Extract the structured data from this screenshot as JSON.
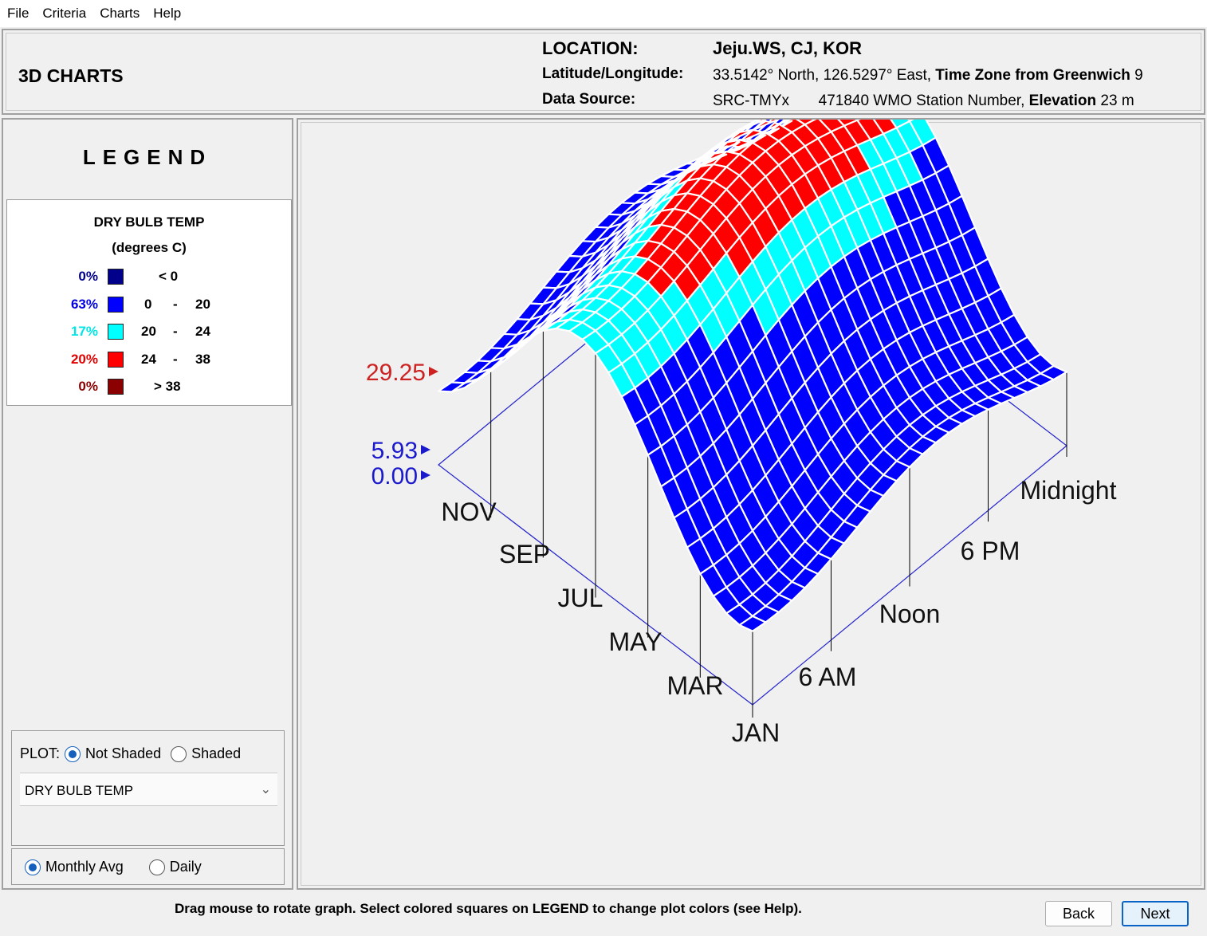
{
  "menu": [
    "File",
    "Criteria",
    "Charts",
    "Help"
  ],
  "header": {
    "title": "3D CHARTS",
    "location_label": "LOCATION:",
    "location_value": "Jeju.WS, CJ, KOR",
    "latlon_label": "Latitude/Longitude:",
    "latlon_value": "33.5142° North, 126.5297° East,",
    "tz_label": "Time Zone from Greenwich",
    "tz_value": "9",
    "source_label": "Data Source:",
    "source_value": "SRC-TMYx",
    "wmo_value": "471840 WMO Station Number,",
    "elev_label": "Elevation",
    "elev_value": "23 m"
  },
  "legend": {
    "title": "LEGEND",
    "variable": "DRY BULB TEMP",
    "units": "(degrees C)",
    "rows": [
      {
        "pct": "0%",
        "color": "#00008b",
        "pct_color": "#00008b",
        "lo": "< 0",
        "dash": "",
        "hi": ""
      },
      {
        "pct": "63%",
        "color": "#0000ff",
        "pct_color": "#0000e0",
        "lo": "0",
        "dash": "-",
        "hi": "20"
      },
      {
        "pct": "17%",
        "color": "#00ffff",
        "pct_color": "#00e5e5",
        "lo": "20",
        "dash": "-",
        "hi": "24"
      },
      {
        "pct": "20%",
        "color": "#ff0000",
        "pct_color": "#e00000",
        "lo": "24",
        "dash": "-",
        "hi": "38"
      },
      {
        "pct": "0%",
        "color": "#8b0000",
        "pct_color": "#8b0000",
        "lo": "> 38",
        "dash": "",
        "hi": ""
      }
    ]
  },
  "plot": {
    "label": "PLOT:",
    "option_not_shaded": "Not Shaded",
    "option_shaded": "Shaded",
    "selected": "not_shaded",
    "variable_select": "DRY BULB TEMP",
    "option_monthly": "Monthly Avg",
    "option_daily": "Daily",
    "period_selected": "monthly"
  },
  "chart_data": {
    "type": "surface",
    "z_markers": [
      {
        "label": "29.25",
        "color": "#cc2222"
      },
      {
        "label": "5.93",
        "color": "#1a1acc"
      },
      {
        "label": "0.00",
        "color": "#1a1acc"
      }
    ],
    "month_axis_labels": [
      "JAN",
      "MAR",
      "MAY",
      "JUL",
      "SEP",
      "NOV"
    ],
    "hour_axis_labels": [
      "6 AM",
      "Noon",
      "6 PM",
      "Midnight"
    ],
    "z_range": [
      0.0,
      29.25
    ],
    "color_thresholds": [
      {
        "max": 0,
        "color": "#00008b"
      },
      {
        "max": 20,
        "color": "#0000ff"
      },
      {
        "max": 24,
        "color": "#00ffff"
      },
      {
        "max": 38,
        "color": "#ff0000"
      },
      {
        "max": 999,
        "color": "#8b0000"
      }
    ]
  },
  "footer": {
    "hint": "Drag mouse to rotate graph.  Select colored squares on LEGEND to change plot colors (see Help).",
    "back_label": "Back",
    "next_label": "Next"
  }
}
